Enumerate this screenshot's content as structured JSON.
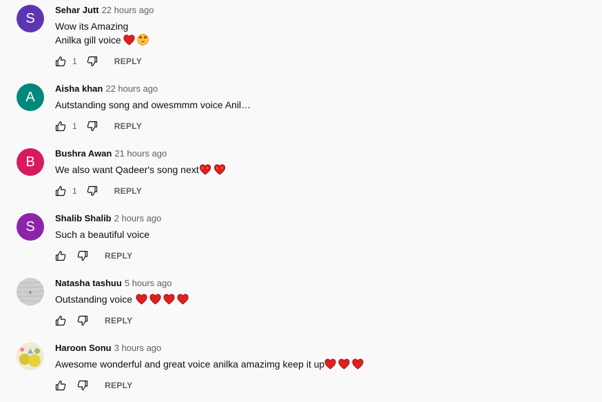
{
  "comments": [
    {
      "author": "Sehar Jutt",
      "time": "22 hours ago",
      "avatar_letter": "S",
      "avatar_color": "#5e35b1",
      "lines": [
        "Wow its Amazing",
        "Anilka gill voice"
      ],
      "likes": "1",
      "reply_label": "REPLY"
    },
    {
      "author": "Aisha khan",
      "time": "22 hours ago",
      "avatar_letter": "A",
      "avatar_color": "#00897b",
      "lines": [
        "Autstanding song and owesmmm voice Anil…"
      ],
      "likes": "1",
      "reply_label": "REPLY"
    },
    {
      "author": "Bushra Awan",
      "time": "21 hours ago",
      "avatar_letter": "B",
      "avatar_color": "#d81b60",
      "lines": [
        "We also want Qadeer's song next"
      ],
      "likes": "1",
      "reply_label": "REPLY"
    },
    {
      "author": "Shalib Shalib",
      "time": "2 hours ago",
      "avatar_letter": "S",
      "avatar_color": "#8e24aa",
      "lines": [
        "Such a beautiful voice"
      ],
      "likes": "",
      "reply_label": "REPLY"
    },
    {
      "author": "Natasha tashuu",
      "time": "5 hours ago",
      "avatar_letter": "",
      "avatar_color": "#c9c9c9",
      "lines": [
        "Outstanding voice"
      ],
      "likes": "",
      "reply_label": "REPLY"
    },
    {
      "author": "Haroon Sonu",
      "time": "3 hours ago",
      "avatar_letter": "",
      "avatar_color": "#e9e1a8",
      "lines": [
        "Awesome wonderful and great voice anilka amazimg keep it up"
      ],
      "likes": "",
      "reply_label": "REPLY"
    }
  ],
  "icons": {
    "like": "thumbs-up-icon",
    "dislike": "thumbs-down-icon",
    "heart": "red-heart-emoji",
    "sparkling_heart": "sparkling-heart-emoji",
    "heart_eyes": "heart-eyes-emoji"
  },
  "colors": {
    "background": "#f9f9f9",
    "text_primary": "#0f0f0f",
    "text_secondary": "#606060",
    "heart": "#e0201e"
  }
}
